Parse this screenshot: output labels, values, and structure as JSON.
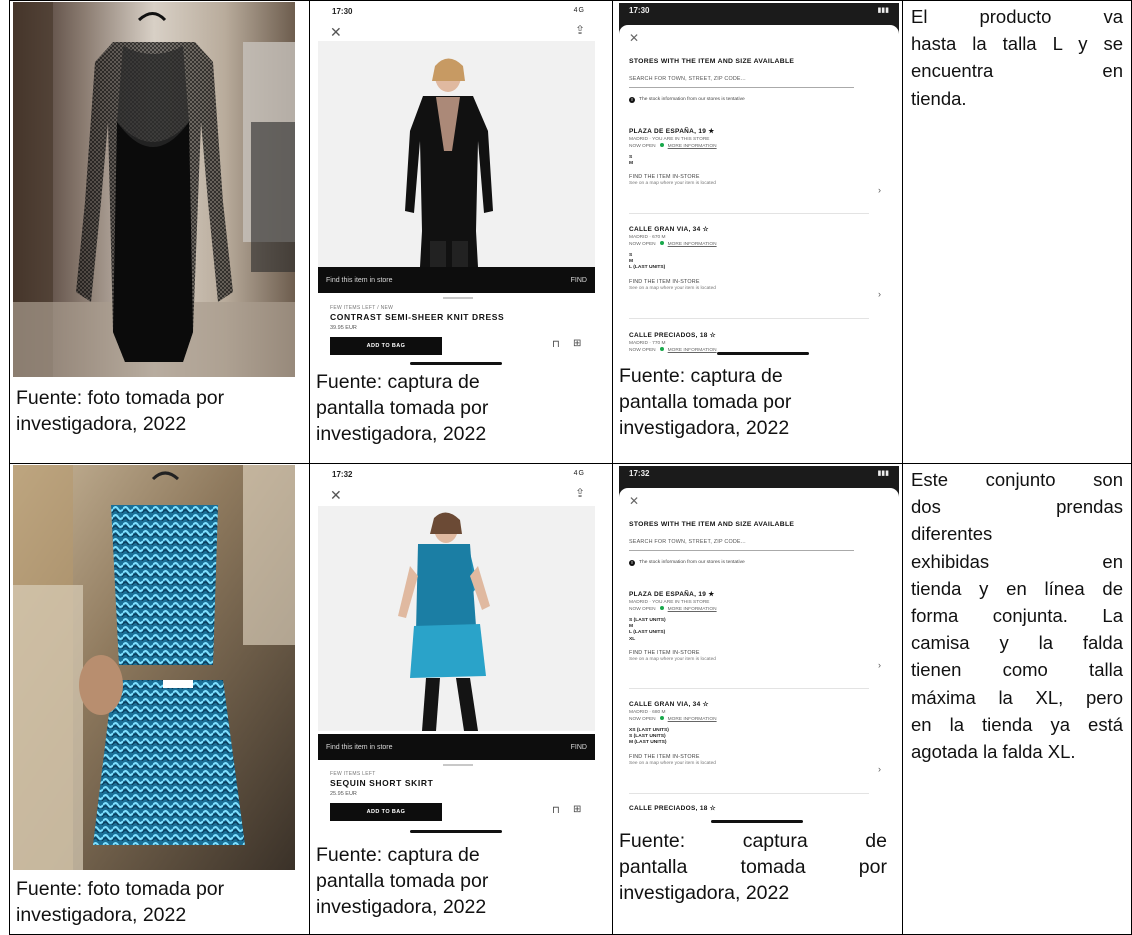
{
  "rows": [
    {
      "photo_caption": [
        "Fuente: foto tomada por",
        "investigadora, 2022"
      ],
      "screenshot_caption": [
        "Fuente: captura de",
        "pantalla tomada por",
        "investigadora, 2022"
      ],
      "store_caption": [
        "Fuente: captura de",
        "pantalla tomada por",
        "investigadora, 2022"
      ],
      "note_lines": [
        "El producto va",
        "hasta la talla L y se",
        "encuentra en",
        "tienda."
      ],
      "product_screen": {
        "time": "17:30",
        "signal": "4G",
        "find_bar_label": "Find this item in store",
        "find_bar_action": "FIND",
        "meta": "FEW ITEMS LEFT / NEW",
        "name": "CONTRAST SEMI-SHEER KNIT DRESS",
        "price": "39.95 EUR",
        "add_to_bag": "ADD TO BAG"
      },
      "store_screen": {
        "time": "17:30",
        "heading": "STORES WITH THE ITEM AND SIZE AVAILABLE",
        "search_placeholder": "SEARCH FOR TOWN, STREET, ZIP CODE...",
        "info": "The stock information from our stores is tentative",
        "stores": [
          {
            "name": "PLAZA DE ESPAÑA, 19",
            "star": "★",
            "sub": "MADRID · YOU ARE IN THIS STORE",
            "open": "NOW OPEN",
            "more": "MORE INFORMATION",
            "sizes": [
              "S",
              "M"
            ],
            "find": "FIND THE ITEM IN-STORE",
            "find_sub": "See on a map where your item is located"
          },
          {
            "name": "CALLE GRAN VIA, 34",
            "star": "☆",
            "sub": "MADRID · 670 M",
            "open": "NOW OPEN",
            "more": "MORE INFORMATION",
            "sizes": [
              "S",
              "M",
              "L (LAST UNITS)"
            ],
            "find": "FIND THE ITEM IN-STORE",
            "find_sub": "See on a map where your item is located"
          },
          {
            "name": "CALLE PRECIADOS, 18",
            "star": "☆",
            "sub": "MADRID · 770 M",
            "open": "NOW OPEN",
            "more": "MORE INFORMATION"
          }
        ]
      }
    },
    {
      "photo_caption": [
        "Fuente: foto tomada por",
        "investigadora, 2022"
      ],
      "screenshot_caption": [
        "Fuente: captura de",
        "pantalla tomada por",
        "investigadora, 2022"
      ],
      "store_caption": [
        "Fuente: captura de",
        "pantalla tomada por",
        "investigadora, 2022"
      ],
      "note_lines": [
        "Este conjunto son",
        "dos prendas",
        "diferentes",
        "exhibidas en",
        "tienda y en línea de",
        "forma conjunta. La",
        "camisa y la falda",
        "tienen como talla",
        "máxima la XL, pero",
        "en la tienda ya está",
        "agotada la falda XL."
      ],
      "product_screen": {
        "time": "17:32",
        "signal": "4G",
        "find_bar_label": "Find this item in store",
        "find_bar_action": "FIND",
        "meta": "FEW ITEMS LEFT",
        "name": "SEQUIN SHORT SKIRT",
        "price": "25.95 EUR",
        "add_to_bag": "ADD TO BAG"
      },
      "store_screen": {
        "time": "17:32",
        "heading": "STORES WITH THE ITEM AND SIZE AVAILABLE",
        "search_placeholder": "SEARCH FOR TOWN, STREET, ZIP CODE...",
        "info": "The stock information from our stores is tentative",
        "stores": [
          {
            "name": "PLAZA DE ESPAÑA, 19",
            "star": "★",
            "sub": "MADRID · YOU ARE IN THIS STORE",
            "open": "NOW OPEN",
            "more": "MORE INFORMATION",
            "sizes": [
              "S (LAST UNITS)",
              "M",
              "L (LAST UNITS)",
              "XL"
            ],
            "find": "FIND THE ITEM IN-STORE",
            "find_sub": "See on a map where your item is located"
          },
          {
            "name": "CALLE GRAN VIA, 34",
            "star": "☆",
            "sub": "MADRID · 680 M",
            "open": "NOW OPEN",
            "more": "MORE INFORMATION",
            "sizes": [
              "XS (LAST UNITS)",
              "S (LAST UNITS)",
              "M (LAST UNITS)"
            ],
            "find": "FIND THE ITEM IN-STORE",
            "find_sub": "See on a map where your item is located"
          },
          {
            "name": "CALLE PRECIADOS, 18",
            "star": "☆"
          }
        ]
      }
    }
  ]
}
